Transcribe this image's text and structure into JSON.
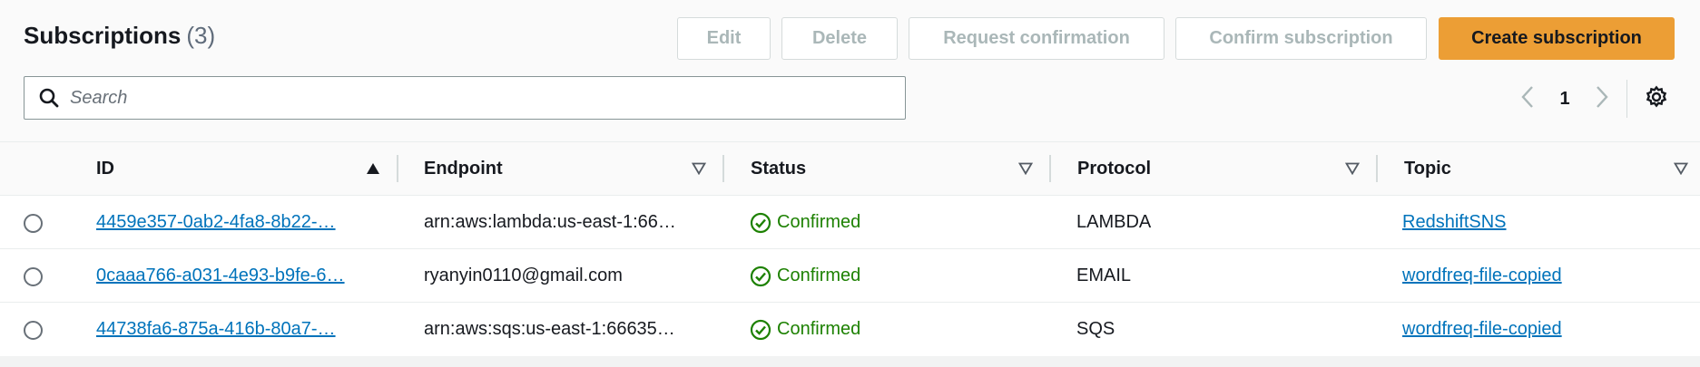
{
  "header": {
    "title": "Subscriptions",
    "count": "(3)"
  },
  "actions": {
    "edit": "Edit",
    "delete": "Delete",
    "request_confirmation": "Request confirmation",
    "confirm_subscription": "Confirm subscription",
    "create_subscription": "Create subscription"
  },
  "search": {
    "placeholder": "Search",
    "value": ""
  },
  "pagination": {
    "current_page": "1"
  },
  "table": {
    "columns": [
      {
        "label": "ID",
        "sort": "ascending"
      },
      {
        "label": "Endpoint",
        "sort": "none"
      },
      {
        "label": "Status",
        "sort": "none"
      },
      {
        "label": "Protocol",
        "sort": "none"
      },
      {
        "label": "Topic",
        "sort": "none"
      }
    ],
    "rows": [
      {
        "id": "4459e357-0ab2-4fa8-8b22-…",
        "endpoint": "arn:aws:lambda:us-east-1:66…",
        "status": "Confirmed",
        "protocol": "LAMBDA",
        "topic": "RedshiftSNS"
      },
      {
        "id": "0caaa766-a031-4e93-b9fe-6…",
        "endpoint": "ryanyin0110@gmail.com",
        "status": "Confirmed",
        "protocol": "EMAIL",
        "topic": "wordfreq-file-copied"
      },
      {
        "id": "44738fa6-875a-416b-80a7-…",
        "endpoint": "arn:aws:sqs:us-east-1:66635…",
        "status": "Confirmed",
        "protocol": "SQS",
        "topic": "wordfreq-file-copied"
      }
    ]
  },
  "icons": {
    "search": "search-icon",
    "prev": "chevron-left-icon",
    "next": "chevron-right-icon",
    "settings": "gear-icon",
    "sort_asc": "caret-up-filled-icon",
    "sort_none": "caret-down-outline-icon",
    "status_ok": "check-circle-icon"
  },
  "colors": {
    "primary_button": "#ec9e35",
    "link": "#0073bb",
    "status_success": "#1d8102",
    "disabled_text": "#aab7b8"
  }
}
